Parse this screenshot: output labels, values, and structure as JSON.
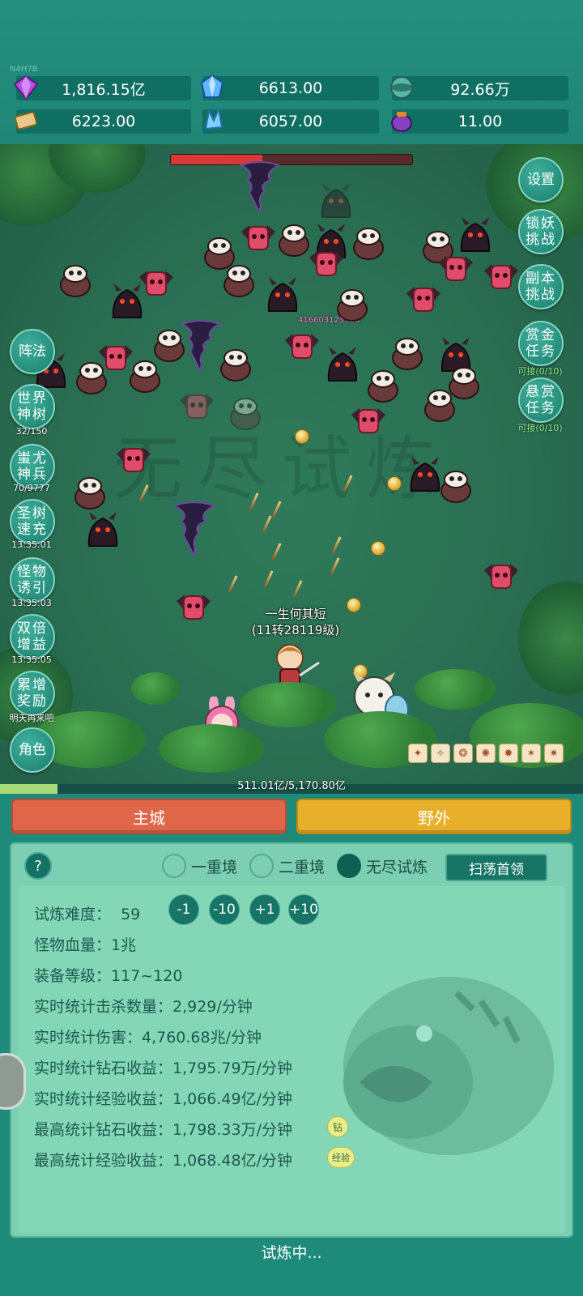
{
  "version": "N4H7B",
  "resources": [
    {
      "icon": "purple-gem-icon",
      "value": "1,816.15亿"
    },
    {
      "icon": "blue-crystal-icon",
      "value": "6613.00"
    },
    {
      "icon": "teal-orb-icon",
      "value": "92.66万"
    },
    {
      "icon": "scroll-icon",
      "value": "6223.00"
    },
    {
      "icon": "ice-shard-icon",
      "value": "6057.00"
    },
    {
      "icon": "purple-pot-icon",
      "value": "11.00"
    }
  ],
  "boss_hp_fraction": 0.38,
  "right_buttons": [
    {
      "label": "设置",
      "sub": ""
    },
    {
      "label": "锁妖挑战",
      "sub": ""
    },
    {
      "label": "副本挑战",
      "sub": ""
    },
    {
      "label": "赏金任务",
      "sub": "可接(0/10)"
    },
    {
      "label": "悬赏任务",
      "sub": "可接(0/10)"
    }
  ],
  "left_buttons": [
    {
      "label": "阵法",
      "sub": ""
    },
    {
      "label": "世界神树",
      "sub": "32/150"
    },
    {
      "label": "蚩尤神兵",
      "sub": "70/9777"
    },
    {
      "label": "圣树速充",
      "sub": "13:35:01"
    },
    {
      "label": "怪物诱引",
      "sub": "13:35:03"
    },
    {
      "label": "双倍增益",
      "sub": "13:35:05"
    },
    {
      "label": "累增奖励",
      "sub": "明天再来吧"
    },
    {
      "label": "角色",
      "sub": ""
    }
  ],
  "damage_number": "41660312593S",
  "hero": {
    "name": "一生何其短",
    "level": "(11转28119级)"
  },
  "exp": {
    "text": "511.01亿/5,170.80亿",
    "fraction": 0.099
  },
  "tabs": {
    "main_city": "主城",
    "wild": "野外"
  },
  "panel": {
    "help": "?",
    "modes": [
      {
        "label": "一重境",
        "selected": false
      },
      {
        "label": "二重境",
        "selected": false
      },
      {
        "label": "无尽试炼",
        "selected": true
      }
    ],
    "sweep_button": "扫荡首领",
    "difficulty_label": "试炼难度：",
    "difficulty_value": "59",
    "difficulty_buttons": [
      "-1",
      "-10",
      "+1",
      "+10"
    ],
    "stats": [
      "怪物血量：1兆",
      "装备等级：117~120",
      "实时统计击杀数量：2,929/分钟",
      "实时统计伤害：4,760.68兆/分钟",
      "实时统计钻石收益：1,795.79万/分钟",
      "实时统计经验收益：1,066.49亿/分钟",
      "最高统计钻石收益：1,798.33万/分钟",
      "最高统计经验收益：1,068.48亿/分钟"
    ],
    "badge_diamond": "钻",
    "badge_exp": "经验",
    "status": "试炼中..."
  },
  "colors": {
    "main_city": "#e0664a",
    "wild": "#e8b02a",
    "panel": "#7ccfb2",
    "teal": "#1d8a7a"
  }
}
